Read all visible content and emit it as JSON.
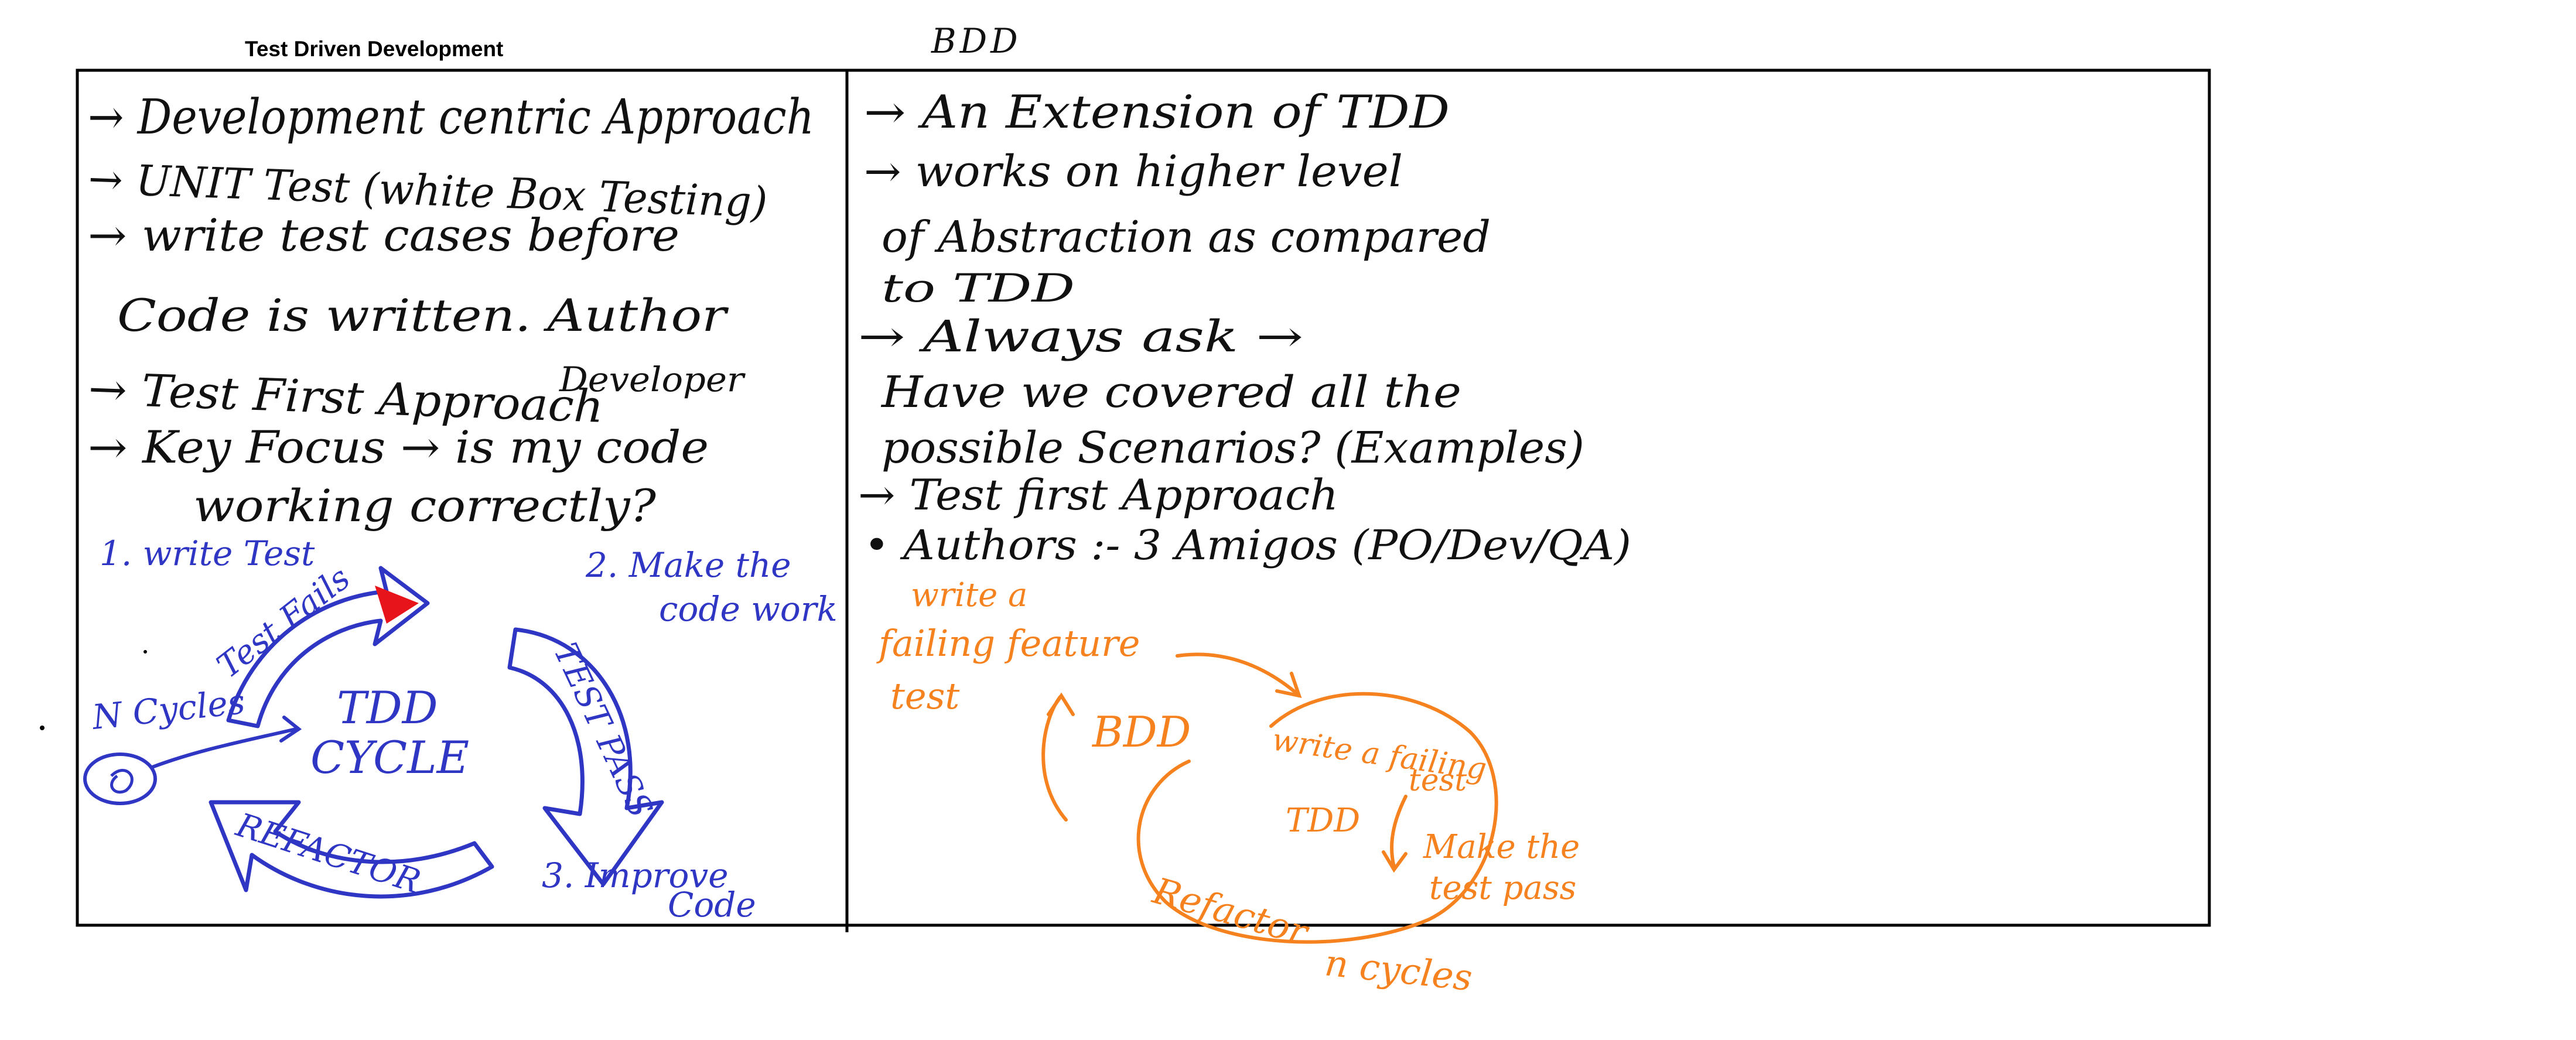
{
  "colors": {
    "ink_black": "#111111",
    "ink_blue": "#2f36c4",
    "ink_orange": "#f5821f",
    "ink_red": "#e8141c"
  },
  "tdd": {
    "heading": "Test Driven Development",
    "notes": [
      "→ Development centric Approach",
      "→ UNIT Test (white Box Testing)",
      "→ write test cases before",
      "Code is written. Author",
      "Developer",
      "→ Test First Approach",
      "→ Key Focus → is my code",
      "working correctly?"
    ],
    "cycle": {
      "center_line1": "TDD",
      "center_line2": "CYCLE",
      "step1": "1. write Test",
      "step2_line1": "2. Make the",
      "step2_line2": "code work",
      "step3_line1": "3. Improve",
      "step3_line2": "Code",
      "arrow_top": "Test Fails",
      "arrow_right": "TEST PASS",
      "arrow_bottom": "REFACTOR",
      "n_cycles": "N Cycles"
    }
  },
  "bdd": {
    "heading": "BDD",
    "notes": [
      "→ An Extension of TDD",
      "→ works on higher level",
      "of Abstraction as compared",
      "to TDD",
      "→ Always ask →",
      "Have we covered all the",
      "possible Scenarios? (Examples)",
      "→ Test first Approach",
      "• Authors :- 3 Amigos (PO/Dev/QA)"
    ],
    "diagram": {
      "outer_label_line1": "write a",
      "outer_label_line2": "failing feature",
      "outer_label_line3": "test",
      "outer_center": "BDD",
      "inner_center": "TDD",
      "inner_write_line1": "write a failing",
      "inner_write_line2": "test",
      "inner_make_line1": "Make the",
      "inner_make_line2": "test pass",
      "inner_refactor": "Refactor",
      "n_cycles": "n cycles"
    }
  }
}
